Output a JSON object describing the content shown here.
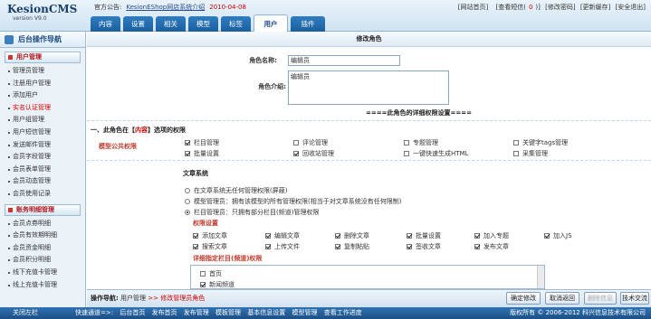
{
  "app": {
    "title": "KesionCMS",
    "version": "version V9.0"
  },
  "notice": {
    "label": "官方公告:",
    "link": "KesionEShop网店系统介绍",
    "date": "2010-04-08"
  },
  "toplinks": [
    "[网站首页]",
    "[查看短信(",
    "0",
    ")]",
    "[修改密码]",
    "[更新缓存]",
    "[安全退出]"
  ],
  "tabs": [
    "内容",
    "设置",
    "相关",
    "模型",
    "标签",
    "用户",
    "插件"
  ],
  "sidebar": {
    "title": "后台操作导航",
    "section1": "用户管理",
    "items1": [
      "管理员管理",
      "注册用户管理",
      "添加用户",
      "实名认证管理",
      "用户组管理",
      "用户短信管理",
      "发送邮件管理",
      "会员字段管理",
      "会员表单管理",
      "会员动态管理",
      "会员使用记录"
    ],
    "section2": "账务明细管理",
    "items2": [
      "会员点券明细",
      "会员有效期明细",
      "会员资金明细",
      "会员积分明细",
      "线下充值卡管理",
      "线上充值卡管理"
    ]
  },
  "form": {
    "page_title": "修改角色",
    "role_name_label": "角色名称:",
    "role_name_value": "编辑员",
    "role_desc_label": "角色介绍:",
    "role_desc_value": "编辑员",
    "perm_title": "====此角色的详细权限设置====",
    "section_head_pre": "一、此角色在【",
    "section_head_hl": "内容",
    "section_head_post": "】选项的权限",
    "model_public_label": "模型公共权限",
    "model_checks": [
      {
        "label": "栏目管理",
        "checked": true
      },
      {
        "label": "评论管理",
        "checked": false
      },
      {
        "label": "专题管理",
        "checked": false
      },
      {
        "label": "关键字tags管理",
        "checked": false
      },
      {
        "label": "批量设置",
        "checked": true
      },
      {
        "label": "回收站管理",
        "checked": true
      },
      {
        "label": "一键快速生成HTML",
        "checked": false
      },
      {
        "label": "采集管理",
        "checked": false
      }
    ],
    "article_system": "文章系统",
    "radios": [
      {
        "label": "在文章系统无任何管理权限(屏蔽)",
        "checked": false
      },
      {
        "label": "模型管理员：拥有该模型的所有管理权限(相当于对文章系统没有任何限制)",
        "checked": false
      },
      {
        "label": "栏目管理员：只拥有部分栏目(频道)管理权限",
        "checked": true
      }
    ],
    "perm_setting_label": "权限设置",
    "perm_checks": [
      {
        "label": "添加文章",
        "checked": true
      },
      {
        "label": "编辑文章",
        "checked": true
      },
      {
        "label": "删除文章",
        "checked": true
      },
      {
        "label": "批量设置",
        "checked": true
      },
      {
        "label": "加入专题",
        "checked": true
      },
      {
        "label": "加入JS",
        "checked": true
      },
      {
        "label": "搜索文章",
        "checked": true
      },
      {
        "label": "上传文件",
        "checked": true
      },
      {
        "label": "复制粘贴",
        "checked": true
      },
      {
        "label": "签收文章",
        "checked": true
      },
      {
        "label": "发布文章",
        "checked": true
      }
    ],
    "detail_label": "详细指定栏目(频道)权限",
    "tree_items": [
      {
        "label": "首页",
        "checked": false
      },
      {
        "label": "新闻频道",
        "checked": true
      }
    ]
  },
  "bottom": {
    "nav_label": "操作导航:",
    "nav_path1": "用户管理",
    "nav_sep": ">>",
    "nav_path2": "修改管理员角色",
    "buttons": [
      "确定修改",
      "取消返回",
      "删除信息",
      "技术交流"
    ]
  },
  "footer": {
    "exit": "关闭左栏",
    "nav_label": "快速通道=>:",
    "nav_items": [
      "后台首页",
      "发布首页",
      "发布管理",
      "模板管理",
      "基本信息设置",
      "模型管理",
      "查看工作进度"
    ],
    "copyright": "版权所有 © 2006-2012 科兴信息技术有限公司"
  }
}
